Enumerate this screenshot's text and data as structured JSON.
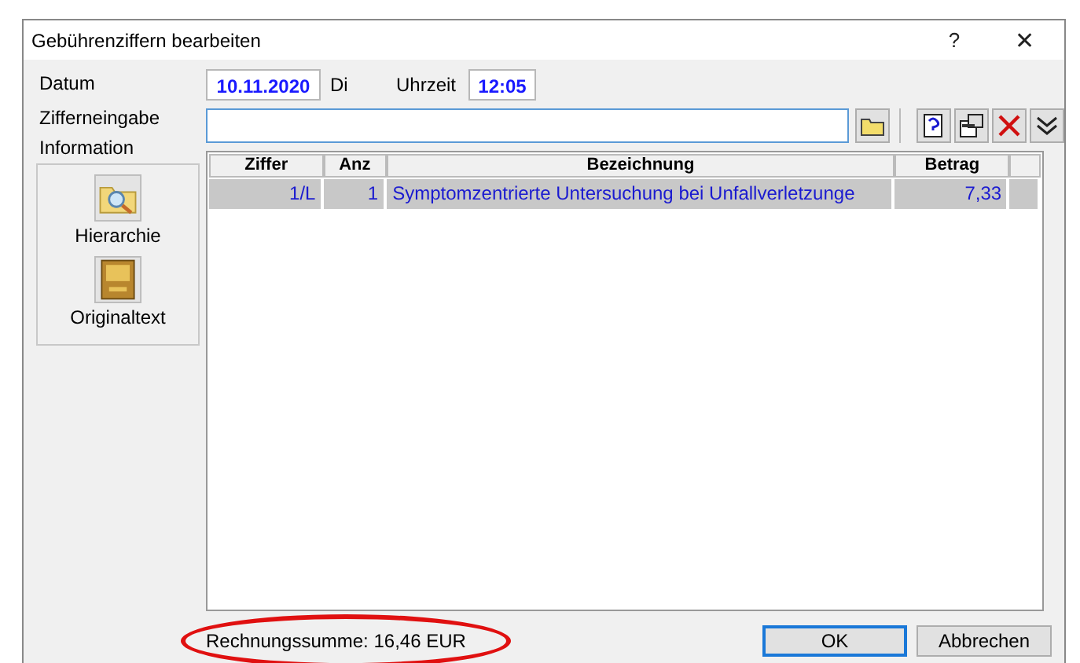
{
  "window": {
    "title": "Gebührenziffern bearbeiten",
    "help": "?",
    "close": "✕"
  },
  "datum": {
    "label": "Datum",
    "value": "10.11.2020",
    "weekday": "Di"
  },
  "uhrzeit": {
    "label": "Uhrzeit",
    "value": "12:05"
  },
  "ziffereingabe": {
    "label": "Zifferneingabe"
  },
  "information": {
    "label": "Information",
    "items": [
      {
        "kind": "hierarchy",
        "label": "Hierarchie"
      },
      {
        "kind": "book",
        "label": "Originaltext"
      }
    ]
  },
  "table": {
    "columns": [
      "Ziffer",
      "Anz",
      "Bezeichnung",
      "Betrag"
    ],
    "rows": [
      {
        "selected": true,
        "cells": [
          "1/L",
          "1",
          "Symptomzentrierte Untersuchung bei Unfallverletzunge",
          "7,33"
        ]
      }
    ]
  },
  "footer": {
    "total": "Rechnungssumme: 16,46 EUR",
    "highlighted": true
  },
  "buttons": [
    {
      "label": "OK",
      "default": true
    },
    {
      "label": "Abbrechen",
      "default": false
    }
  ]
}
